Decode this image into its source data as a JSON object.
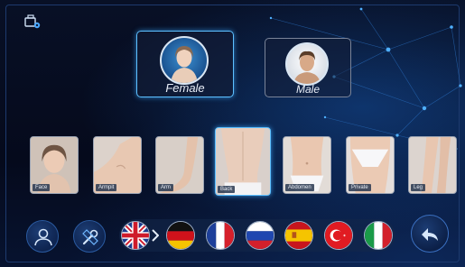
{
  "header": {
    "device_icon": "device-settings-icon"
  },
  "gender": {
    "options": [
      {
        "label": "Female",
        "selected": true
      },
      {
        "label": "Male",
        "selected": false
      }
    ]
  },
  "body_parts": {
    "items": [
      {
        "label": "Face",
        "selected": false
      },
      {
        "label": "Armpit",
        "selected": false
      },
      {
        "label": "Arm",
        "selected": false
      },
      {
        "label": "Back",
        "selected": true
      },
      {
        "label": "Abdomen",
        "selected": false
      },
      {
        "label": "Private",
        "selected": false
      },
      {
        "label": "Leg",
        "selected": false
      }
    ]
  },
  "toolbar": {
    "user_icon": "user-profile-icon",
    "tools_icon": "tools-icon",
    "back_icon": "back-arrow-icon"
  },
  "languages": [
    {
      "country": "United Kingdom",
      "selected": true
    },
    {
      "country": "Germany",
      "selected": false
    },
    {
      "country": "France",
      "selected": false
    },
    {
      "country": "Russia",
      "selected": false
    },
    {
      "country": "Spain",
      "selected": false
    },
    {
      "country": "Turkey",
      "selected": false
    },
    {
      "country": "Italy",
      "selected": false
    }
  ],
  "colors": {
    "accent": "#5ec0ff",
    "background": "#05081a",
    "frame": "#1d3a6e"
  }
}
